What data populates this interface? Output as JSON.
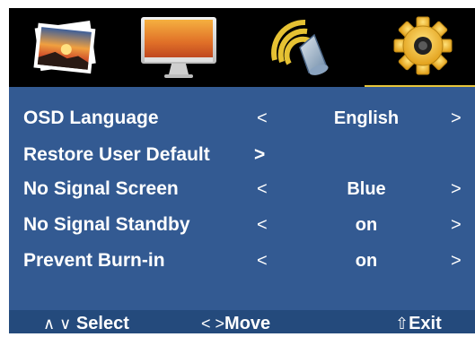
{
  "tabs": [
    {
      "name": "picture",
      "icon": "photo-icon"
    },
    {
      "name": "display",
      "icon": "monitor-icon"
    },
    {
      "name": "audio",
      "icon": "speaker-icon"
    },
    {
      "name": "setup",
      "icon": "gear-icon",
      "selected": true
    }
  ],
  "settings": {
    "osd_language": {
      "label": "OSD Language",
      "value": "English",
      "left": "<",
      "right": ">"
    },
    "restore_default": {
      "label": "Restore User Default",
      "right": ">"
    },
    "no_signal_screen": {
      "label": "No Signal Screen",
      "value": "Blue",
      "left": "<",
      "right": ">"
    },
    "no_signal_standby": {
      "label": "No Signal Standby",
      "value": "on",
      "left": "<",
      "right": ">"
    },
    "prevent_burn_in": {
      "label": "Prevent Burn-in",
      "value": "on",
      "left": "<",
      "right": ">"
    }
  },
  "footer": {
    "select_symbols": "∧ ∨",
    "select_label": "Select",
    "move_symbols": "<  >",
    "move_label": "Move",
    "exit_symbol": "⇧",
    "exit_label": "Exit"
  },
  "colors": {
    "panel": "#335a92",
    "tabbar": "#000000",
    "footer": "#244a7c",
    "accent": "#e8c63a"
  }
}
